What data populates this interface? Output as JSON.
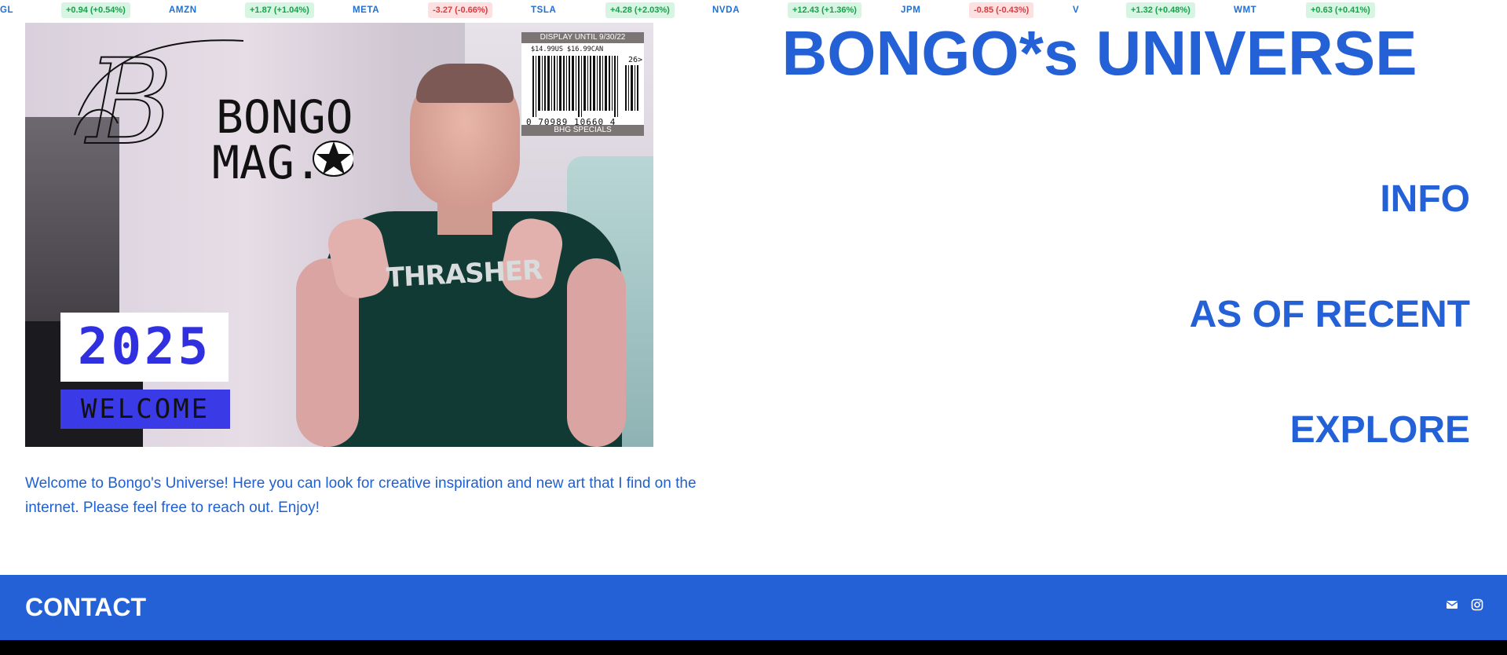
{
  "ticker": [
    {
      "symbol": "GL",
      "change": "+0.94 (+0.54%)",
      "dir": "up"
    },
    {
      "symbol": "AMZN",
      "change": "+1.87 (+1.04%)",
      "dir": "up"
    },
    {
      "symbol": "META",
      "change": "-3.27 (-0.66%)",
      "dir": "down"
    },
    {
      "symbol": "TSLA",
      "change": "+4.28 (+2.03%)",
      "dir": "up"
    },
    {
      "symbol": "NVDA",
      "change": "+12.43 (+1.36%)",
      "dir": "up"
    },
    {
      "symbol": "JPM",
      "change": "-0.85 (-0.43%)",
      "dir": "down"
    },
    {
      "symbol": "V",
      "change": "+1.32 (+0.48%)",
      "dir": "up"
    },
    {
      "symbol": "WMT",
      "change": "+0.63 (+0.41%)",
      "dir": "up"
    }
  ],
  "hero": {
    "logo_text_line1": "BONGO",
    "logo_text_line2": "MAG.",
    "barcode_top": "DISPLAY UNTIL 9/30/22",
    "barcode_price": "$14.99US $16.99CAN",
    "barcode_issue": "26>",
    "barcode_number": "0 70989 10660 4",
    "barcode_bottom": "BHG SPECIALS",
    "tee_text": "THRASHER",
    "year": "2025",
    "welcome": "WELCOME"
  },
  "intro": "Welcome to Bongo's Universe! Here you can look for creative inspiration and new art that I find on the internet. Please feel free to reach out. Enjoy!",
  "site_title": "BONGO*s UNIVERSE",
  "nav": {
    "info": "INFO",
    "as_of_recent": "AS OF RECENT",
    "explore": "EXPLORE"
  },
  "footer": {
    "title": "CONTACT",
    "icons": [
      "mail-icon",
      "instagram-icon"
    ]
  },
  "colors": {
    "brand_blue": "#2461d6",
    "welcome_blue": "#3a3ae6",
    "ticker_up": "#15a34a",
    "ticker_down": "#e0383e"
  }
}
